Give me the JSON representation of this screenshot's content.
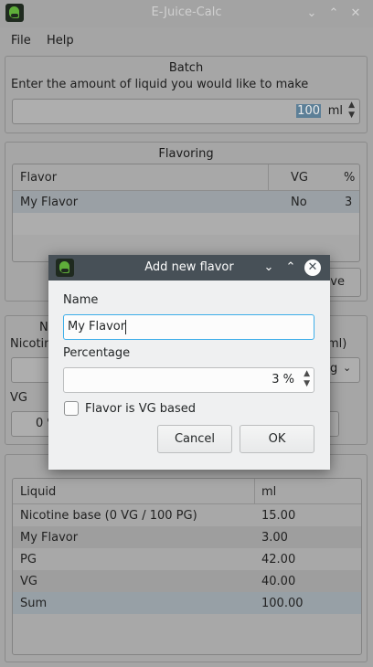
{
  "window": {
    "title": "E-Juice-Calc"
  },
  "menu": [
    "File",
    "Help"
  ],
  "batch": {
    "title": "Batch",
    "prompt": "Enter the amount of liquid you would like to make",
    "amount": "100",
    "unit": "ml"
  },
  "flavoring": {
    "title": "Flavoring",
    "columns": [
      "Flavor",
      "VG",
      "%"
    ],
    "rows": [
      {
        "flavor": "My Flavor",
        "vg": "No",
        "pct": "3"
      }
    ],
    "remove_partial": "ve"
  },
  "nicotine_partial": {
    "title": "N",
    "label": "Nicotin",
    "unit_partial": "ml)",
    "select_partial": "g",
    "vg_label": "VG",
    "vg_value": "0 %"
  },
  "result": {
    "columns": [
      "Liquid",
      "ml"
    ],
    "rows": [
      {
        "liquid": "Nicotine base (0 VG / 100 PG)",
        "ml": "15.00"
      },
      {
        "liquid": "My Flavor",
        "ml": "3.00"
      },
      {
        "liquid": "PG",
        "ml": "42.00"
      },
      {
        "liquid": "VG",
        "ml": "40.00"
      },
      {
        "liquid": "Sum",
        "ml": "100.00"
      }
    ]
  },
  "dialog": {
    "title": "Add new flavor",
    "name_label": "Name",
    "name_value": "My Flavor",
    "percentage_label": "Percentage",
    "percentage_value": "3 %",
    "checkbox_label": "Flavor is VG based",
    "checkbox_checked": false,
    "cancel_label": "Cancel",
    "ok_label": "OK",
    "accent": "#3daee9"
  }
}
